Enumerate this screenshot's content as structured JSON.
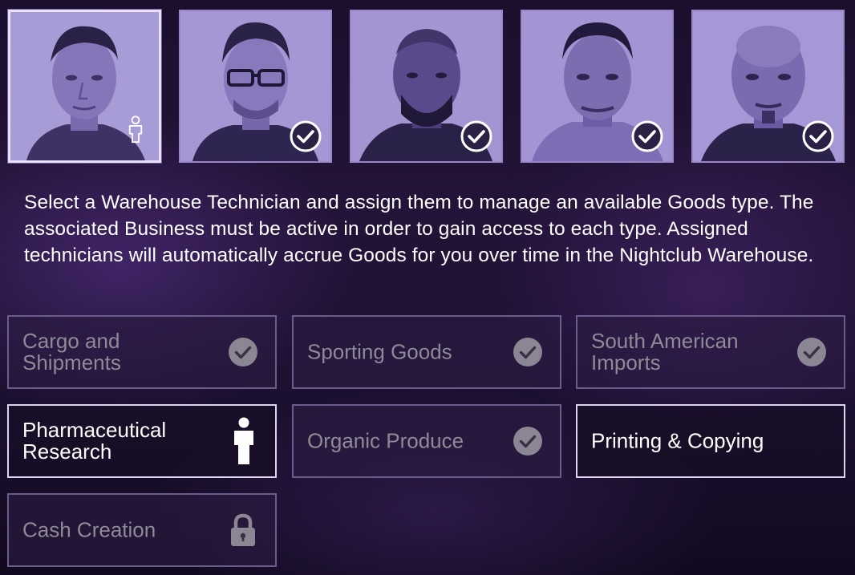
{
  "technicians": [
    {
      "name": "technician-1",
      "status": "assigned-person",
      "selected": true
    },
    {
      "name": "technician-2",
      "status": "check",
      "selected": false
    },
    {
      "name": "technician-3",
      "status": "check",
      "selected": false
    },
    {
      "name": "technician-4",
      "status": "check",
      "selected": false
    },
    {
      "name": "technician-5",
      "status": "check",
      "selected": false
    }
  ],
  "description": "Select a Warehouse Technician and assign them to manage an available Goods type. The associated Business must be active in order to gain access to each type. Assigned technicians will automatically accrue Goods for you over time in the Nightclub Warehouse.",
  "goods": [
    {
      "label": "Cargo and Shipments",
      "icon": "check-icon",
      "state": "assigned"
    },
    {
      "label": "Sporting Goods",
      "icon": "check-icon",
      "state": "assigned"
    },
    {
      "label": "South American Imports",
      "icon": "check-icon",
      "state": "assigned"
    },
    {
      "label": "Pharmaceutical Research",
      "icon": "person-icon",
      "state": "current"
    },
    {
      "label": "Organic Produce",
      "icon": "check-icon",
      "state": "assigned"
    },
    {
      "label": "Printing & Copying",
      "icon": "",
      "state": "available"
    },
    {
      "label": "Cash Creation",
      "icon": "lock-icon",
      "state": "locked"
    }
  ],
  "colors": {
    "panel_border": "#6c5c8c",
    "active_border": "#ddd4f2",
    "inactive_text": "#8e8a96",
    "active_text": "#ffffff",
    "portrait_tint": "#9a8bcc"
  }
}
